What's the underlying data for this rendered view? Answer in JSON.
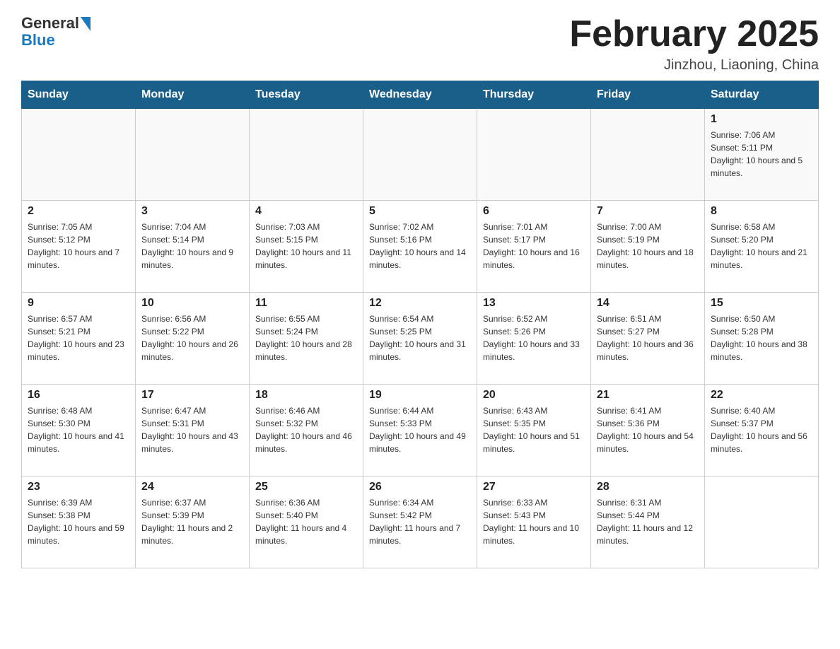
{
  "header": {
    "logo_general": "General",
    "logo_blue": "Blue",
    "month_title": "February 2025",
    "location": "Jinzhou, Liaoning, China"
  },
  "days_of_week": [
    "Sunday",
    "Monday",
    "Tuesday",
    "Wednesday",
    "Thursday",
    "Friday",
    "Saturday"
  ],
  "weeks": [
    [
      {
        "day": "",
        "info": ""
      },
      {
        "day": "",
        "info": ""
      },
      {
        "day": "",
        "info": ""
      },
      {
        "day": "",
        "info": ""
      },
      {
        "day": "",
        "info": ""
      },
      {
        "day": "",
        "info": ""
      },
      {
        "day": "1",
        "info": "Sunrise: 7:06 AM\nSunset: 5:11 PM\nDaylight: 10 hours and 5 minutes."
      }
    ],
    [
      {
        "day": "2",
        "info": "Sunrise: 7:05 AM\nSunset: 5:12 PM\nDaylight: 10 hours and 7 minutes."
      },
      {
        "day": "3",
        "info": "Sunrise: 7:04 AM\nSunset: 5:14 PM\nDaylight: 10 hours and 9 minutes."
      },
      {
        "day": "4",
        "info": "Sunrise: 7:03 AM\nSunset: 5:15 PM\nDaylight: 10 hours and 11 minutes."
      },
      {
        "day": "5",
        "info": "Sunrise: 7:02 AM\nSunset: 5:16 PM\nDaylight: 10 hours and 14 minutes."
      },
      {
        "day": "6",
        "info": "Sunrise: 7:01 AM\nSunset: 5:17 PM\nDaylight: 10 hours and 16 minutes."
      },
      {
        "day": "7",
        "info": "Sunrise: 7:00 AM\nSunset: 5:19 PM\nDaylight: 10 hours and 18 minutes."
      },
      {
        "day": "8",
        "info": "Sunrise: 6:58 AM\nSunset: 5:20 PM\nDaylight: 10 hours and 21 minutes."
      }
    ],
    [
      {
        "day": "9",
        "info": "Sunrise: 6:57 AM\nSunset: 5:21 PM\nDaylight: 10 hours and 23 minutes."
      },
      {
        "day": "10",
        "info": "Sunrise: 6:56 AM\nSunset: 5:22 PM\nDaylight: 10 hours and 26 minutes."
      },
      {
        "day": "11",
        "info": "Sunrise: 6:55 AM\nSunset: 5:24 PM\nDaylight: 10 hours and 28 minutes."
      },
      {
        "day": "12",
        "info": "Sunrise: 6:54 AM\nSunset: 5:25 PM\nDaylight: 10 hours and 31 minutes."
      },
      {
        "day": "13",
        "info": "Sunrise: 6:52 AM\nSunset: 5:26 PM\nDaylight: 10 hours and 33 minutes."
      },
      {
        "day": "14",
        "info": "Sunrise: 6:51 AM\nSunset: 5:27 PM\nDaylight: 10 hours and 36 minutes."
      },
      {
        "day": "15",
        "info": "Sunrise: 6:50 AM\nSunset: 5:28 PM\nDaylight: 10 hours and 38 minutes."
      }
    ],
    [
      {
        "day": "16",
        "info": "Sunrise: 6:48 AM\nSunset: 5:30 PM\nDaylight: 10 hours and 41 minutes."
      },
      {
        "day": "17",
        "info": "Sunrise: 6:47 AM\nSunset: 5:31 PM\nDaylight: 10 hours and 43 minutes."
      },
      {
        "day": "18",
        "info": "Sunrise: 6:46 AM\nSunset: 5:32 PM\nDaylight: 10 hours and 46 minutes."
      },
      {
        "day": "19",
        "info": "Sunrise: 6:44 AM\nSunset: 5:33 PM\nDaylight: 10 hours and 49 minutes."
      },
      {
        "day": "20",
        "info": "Sunrise: 6:43 AM\nSunset: 5:35 PM\nDaylight: 10 hours and 51 minutes."
      },
      {
        "day": "21",
        "info": "Sunrise: 6:41 AM\nSunset: 5:36 PM\nDaylight: 10 hours and 54 minutes."
      },
      {
        "day": "22",
        "info": "Sunrise: 6:40 AM\nSunset: 5:37 PM\nDaylight: 10 hours and 56 minutes."
      }
    ],
    [
      {
        "day": "23",
        "info": "Sunrise: 6:39 AM\nSunset: 5:38 PM\nDaylight: 10 hours and 59 minutes."
      },
      {
        "day": "24",
        "info": "Sunrise: 6:37 AM\nSunset: 5:39 PM\nDaylight: 11 hours and 2 minutes."
      },
      {
        "day": "25",
        "info": "Sunrise: 6:36 AM\nSunset: 5:40 PM\nDaylight: 11 hours and 4 minutes."
      },
      {
        "day": "26",
        "info": "Sunrise: 6:34 AM\nSunset: 5:42 PM\nDaylight: 11 hours and 7 minutes."
      },
      {
        "day": "27",
        "info": "Sunrise: 6:33 AM\nSunset: 5:43 PM\nDaylight: 11 hours and 10 minutes."
      },
      {
        "day": "28",
        "info": "Sunrise: 6:31 AM\nSunset: 5:44 PM\nDaylight: 11 hours and 12 minutes."
      },
      {
        "day": "",
        "info": ""
      }
    ]
  ]
}
